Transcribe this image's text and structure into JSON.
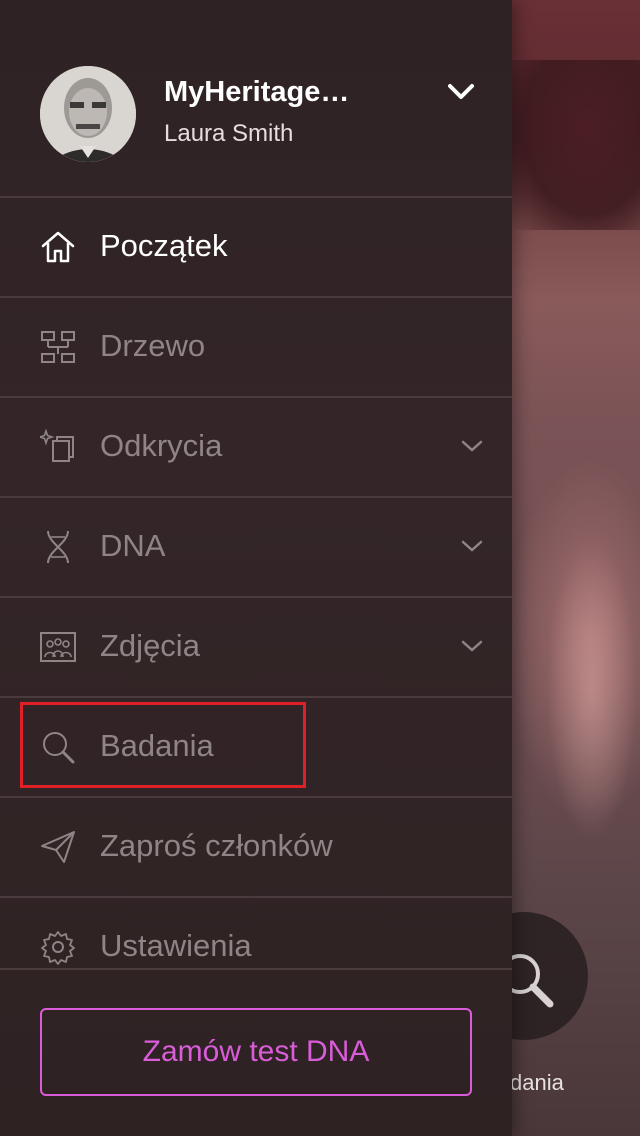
{
  "header": {
    "account_title": "MyHeritage…",
    "user_name": "Laura Smith"
  },
  "menu": {
    "items": [
      {
        "label": "Początek",
        "icon": "home-icon",
        "active": true,
        "expandable": false
      },
      {
        "label": "Drzewo",
        "icon": "tree-icon",
        "active": false,
        "expandable": false
      },
      {
        "label": "Odkrycia",
        "icon": "discoveries-icon",
        "active": false,
        "expandable": true
      },
      {
        "label": "DNA",
        "icon": "dna-icon",
        "active": false,
        "expandable": true
      },
      {
        "label": "Zdjęcia",
        "icon": "photos-icon",
        "active": false,
        "expandable": true
      },
      {
        "label": "Badania",
        "icon": "search-icon",
        "active": false,
        "expandable": false,
        "highlighted": true
      },
      {
        "label": "Zaproś członków",
        "icon": "send-icon",
        "active": false,
        "expandable": false
      },
      {
        "label": "Ustawienia",
        "icon": "gear-icon",
        "active": false,
        "expandable": false
      }
    ]
  },
  "order_button": {
    "label": "Zamów test DNA"
  },
  "background": {
    "fab_label": "dania"
  },
  "colors": {
    "accent": "#d95cd8",
    "highlight_border": "#e02027",
    "active_text": "#ffffff",
    "inactive_text": "#8f8586"
  }
}
